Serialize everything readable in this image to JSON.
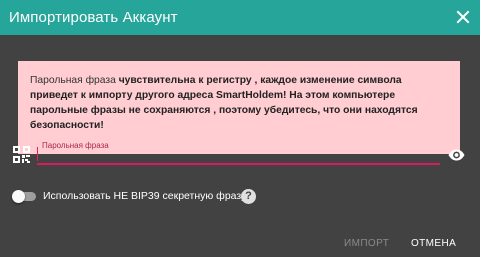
{
  "dialog": {
    "title": "Импортировать Аккаунт",
    "close_icon": "close-icon"
  },
  "warning": {
    "prefix": "Парольная фраза ",
    "bold": "чувствительна к регистру , каждое изменение символа приведет к импорту другого адреса SmartHoldem! На этом компьютере парольные фразы не сохраняются , поэтому убедитесь, что они находятся безопасности!",
    "background": "#ffcdd2"
  },
  "passphrase": {
    "placeholder": "Парольная фраза",
    "value": "",
    "qr_icon": "qr-code-icon",
    "visibility_icon": "eye-icon",
    "accent": "#d81b60"
  },
  "bip39": {
    "label": "Использовать НЕ BIP39 секретную фразу",
    "enabled": false,
    "help": "?"
  },
  "actions": {
    "import_label": "ИМПОРТ",
    "cancel_label": "ОТМЕНА"
  },
  "colors": {
    "header": "#26a69a",
    "body": "#424242"
  }
}
